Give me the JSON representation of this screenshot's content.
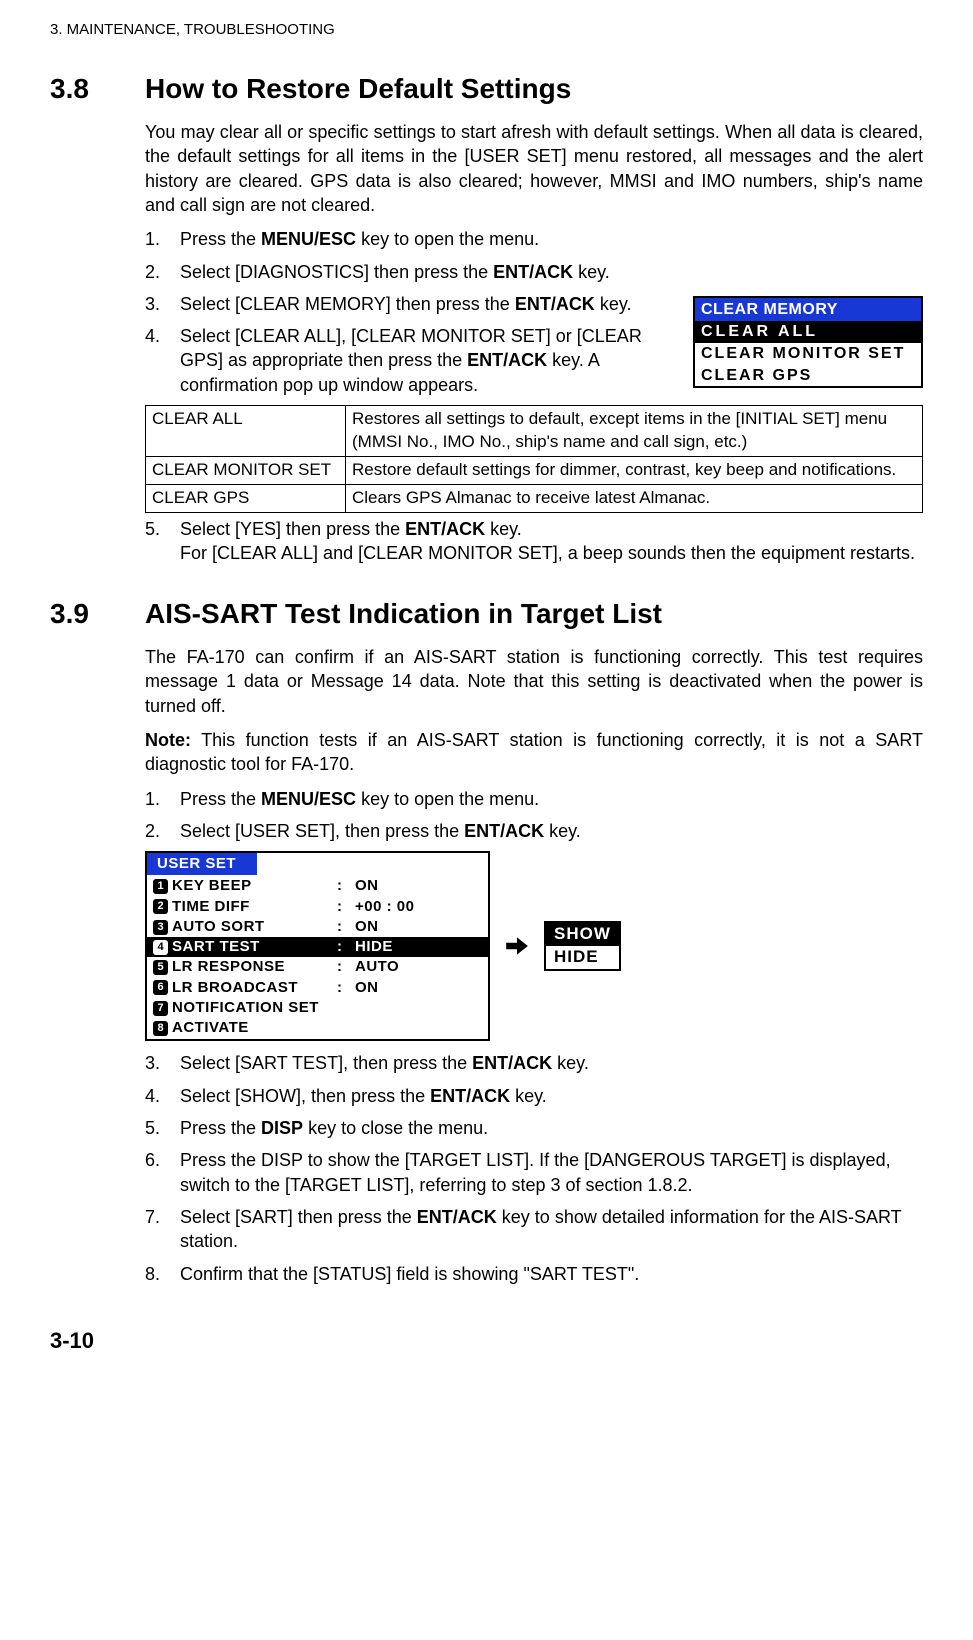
{
  "header": "3.  MAINTENANCE, TROUBLESHOOTING",
  "s38": {
    "num": "3.8",
    "title": "How to Restore Default Settings",
    "intro": "You may clear all or specific settings to start afresh with default settings. When all data is cleared, the default settings for all items in the [USER SET] menu restored, all messages and the alert history are cleared. GPS data is also cleared; however, MMSI and IMO numbers, ship's name and call sign are not cleared.",
    "steps": {
      "1a": "Press the ",
      "1b": "MENU/ESC",
      "1c": " key to open the menu.",
      "2a": "Select [DIAGNOSTICS] then press the ",
      "2b": "ENT/ACK",
      "2c": " key.",
      "3a": "Select [CLEAR MEMORY] then press the ",
      "3b": "ENT/ACK",
      "3c": " key.",
      "4a": "Select [CLEAR ALL], [CLEAR MONITOR SET] or [CLEAR GPS] as appropriate then press the ",
      "4b": "ENT/ACK",
      "4c": " key. A confirmation pop up window appears.",
      "5a": "Select [YES] then press the ",
      "5b": "ENT/ACK",
      "5c": " key.",
      "5d": "For [CLEAR ALL] and [CLEAR MONITOR SET], a beep sounds then the equipment restarts."
    },
    "clear_memory": {
      "title": "CLEAR MEMORY",
      "items": [
        "CLEAR  ALL",
        "CLEAR  MONITOR   SET",
        "CLEAR  GPS"
      ]
    },
    "table": [
      {
        "k": "CLEAR ALL",
        "v": "Restores all settings to default, except items in the [INITIAL SET] menu (MMSI No., IMO No., ship's name and call sign, etc.)"
      },
      {
        "k": "CLEAR MONITOR SET",
        "v": "Restore default settings for dimmer, contrast, key beep and notifications."
      },
      {
        "k": "CLEAR GPS",
        "v": "Clears GPS Almanac to receive latest Almanac."
      }
    ]
  },
  "s39": {
    "num": "3.9",
    "title": "AIS-SART Test Indication in Target List",
    "intro": "The FA-170 can confirm if an AIS-SART station is functioning correctly. This test requires message 1 data or Message 14 data. Note that this setting is deactivated when the power is turned off.",
    "note_b": "Note:",
    "note": " This function tests if an AIS-SART station is functioning correctly, it is not a SART diagnostic tool for FA-170.",
    "steps": {
      "1a": "Press the ",
      "1b": "MENU/ESC",
      "1c": " key to open the menu.",
      "2a": "Select [USER SET], then press the ",
      "2b": "ENT/ACK",
      "2c": " key.",
      "3a": "Select [SART TEST], then press the ",
      "3b": "ENT/ACK",
      "3c": " key.",
      "4a": "Select [SHOW], then press the ",
      "4b": "ENT/ACK",
      "4c": " key.",
      "5a": "Press the ",
      "5b": "DISP",
      "5c": " key to close the menu.",
      "6": "Press the DISP to show the [TARGET LIST]. If the [DANGEROUS TARGET] is displayed, switch to the [TARGET LIST], referring to step 3 of section 1.8.2.",
      "7a": "Select [SART] then press the ",
      "7b": "ENT/ACK",
      "7c": " key to show detailed information for the AIS-SART station.",
      "8": "Confirm that the [STATUS] field is showing \"SART TEST\"."
    },
    "userset": {
      "title": "USER  SET",
      "items": [
        {
          "n": "1",
          "label": "KEY BEEP",
          "val": "ON"
        },
        {
          "n": "2",
          "label": "TIME  DIFF",
          "val": "+00 : 00"
        },
        {
          "n": "3",
          "label": "AUTO SORT",
          "val": "ON"
        },
        {
          "n": "4",
          "label": "SART TEST",
          "val": "HIDE"
        },
        {
          "n": "5",
          "label": "LR RESPONSE",
          "val": "AUTO"
        },
        {
          "n": "6",
          "label": "LR BROADCAST",
          "val": "ON"
        },
        {
          "n": "7",
          "label": "NOTIFICATION SET",
          "val": ""
        },
        {
          "n": "8",
          "label": "ACTIVATE",
          "val": ""
        }
      ]
    },
    "showhide": {
      "sel": "SHOW",
      "other": "HIDE"
    }
  },
  "page_num": "3-10"
}
